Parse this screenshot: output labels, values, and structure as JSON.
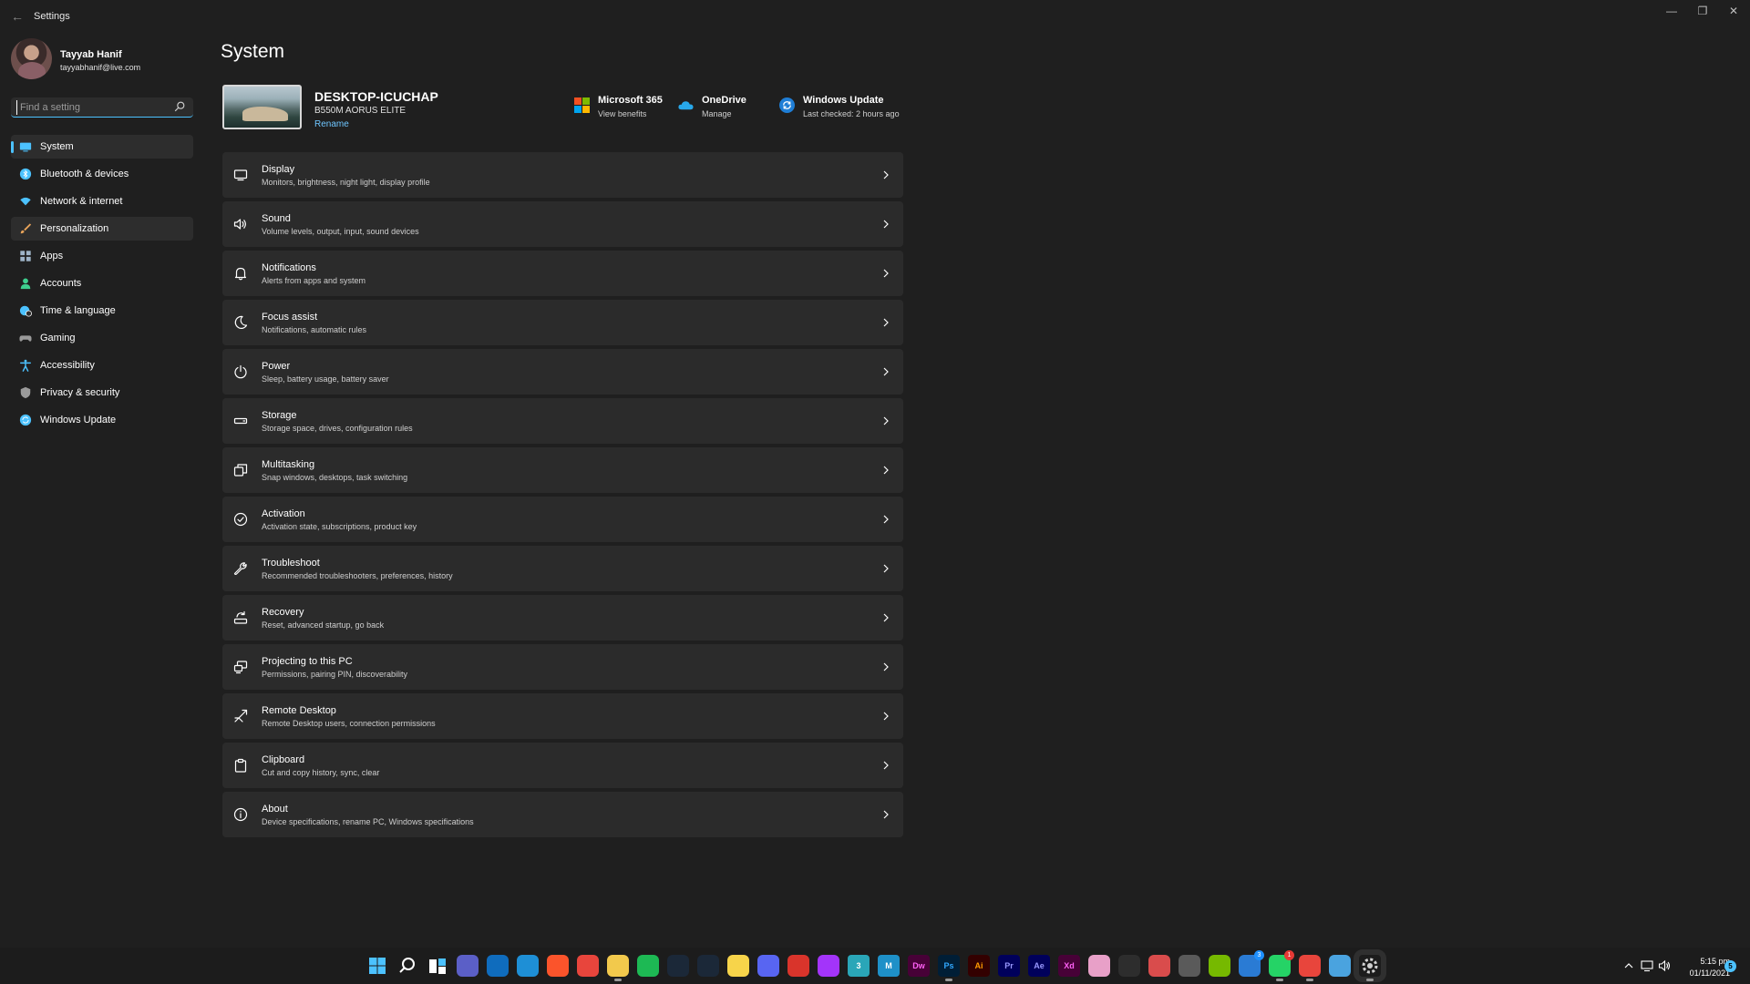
{
  "window": {
    "title": "Settings",
    "back_glyph": "←",
    "minimize_glyph": "—",
    "maximize_glyph": "❐",
    "close_glyph": "✕"
  },
  "user": {
    "name": "Tayyab Hanif",
    "email": "tayyabhanif@live.com"
  },
  "search": {
    "placeholder": "Find a setting",
    "value": ""
  },
  "sidebar": {
    "items": [
      {
        "label": "System",
        "icon": "system-icon",
        "color": "#4cc2ff",
        "active": true
      },
      {
        "label": "Bluetooth & devices",
        "icon": "bluetooth-icon",
        "color": "#4cc2ff"
      },
      {
        "label": "Network & internet",
        "icon": "wifi-icon",
        "color": "#4cc2ff"
      },
      {
        "label": "Personalization",
        "icon": "brush-icon",
        "color": "#e8a35a",
        "hover": true
      },
      {
        "label": "Apps",
        "icon": "apps-icon",
        "color": "#9fb4c8"
      },
      {
        "label": "Accounts",
        "icon": "person-icon",
        "color": "#3ecf8e"
      },
      {
        "label": "Time & language",
        "icon": "globe-clock-icon",
        "color": "#4cc2ff"
      },
      {
        "label": "Gaming",
        "icon": "controller-icon",
        "color": "#9a9a9a"
      },
      {
        "label": "Accessibility",
        "icon": "accessibility-icon",
        "color": "#4cc2ff"
      },
      {
        "label": "Privacy & security",
        "icon": "shield-icon",
        "color": "#9a9a9a"
      },
      {
        "label": "Windows Update",
        "icon": "update-icon",
        "color": "#4cc2ff"
      }
    ]
  },
  "main": {
    "title": "System",
    "device": {
      "name": "DESKTOP-ICUCHAP",
      "model": "B550M AORUS ELITE",
      "rename_label": "Rename"
    },
    "quick_links": [
      {
        "title": "Microsoft 365",
        "subtitle": "View benefits",
        "icon": "microsoft-365-icon"
      },
      {
        "title": "OneDrive",
        "subtitle": "Manage",
        "icon": "onedrive-icon"
      },
      {
        "title": "Windows Update",
        "subtitle": "Last checked: 2 hours ago",
        "icon": "windows-update-icon"
      }
    ],
    "cards": [
      {
        "title": "Display",
        "subtitle": "Monitors, brightness, night light, display profile",
        "icon": "display-icon"
      },
      {
        "title": "Sound",
        "subtitle": "Volume levels, output, input, sound devices",
        "icon": "speaker-icon"
      },
      {
        "title": "Notifications",
        "subtitle": "Alerts from apps and system",
        "icon": "bell-icon"
      },
      {
        "title": "Focus assist",
        "subtitle": "Notifications, automatic rules",
        "icon": "moon-icon"
      },
      {
        "title": "Power",
        "subtitle": "Sleep, battery usage, battery saver",
        "icon": "power-icon"
      },
      {
        "title": "Storage",
        "subtitle": "Storage space, drives, configuration rules",
        "icon": "storage-icon"
      },
      {
        "title": "Multitasking",
        "subtitle": "Snap windows, desktops, task switching",
        "icon": "multitasking-icon"
      },
      {
        "title": "Activation",
        "subtitle": "Activation state, subscriptions, product key",
        "icon": "check-circle-icon"
      },
      {
        "title": "Troubleshoot",
        "subtitle": "Recommended troubleshooters, preferences, history",
        "icon": "wrench-icon"
      },
      {
        "title": "Recovery",
        "subtitle": "Reset, advanced startup, go back",
        "icon": "recovery-icon"
      },
      {
        "title": "Projecting to this PC",
        "subtitle": "Permissions, pairing PIN, discoverability",
        "icon": "projecting-icon"
      },
      {
        "title": "Remote Desktop",
        "subtitle": "Remote Desktop users, connection permissions",
        "icon": "remote-desktop-icon"
      },
      {
        "title": "Clipboard",
        "subtitle": "Cut and copy history, sync, clear",
        "icon": "clipboard-icon"
      },
      {
        "title": "About",
        "subtitle": "Device specifications, rename PC, Windows specifications",
        "icon": "info-icon"
      }
    ]
  },
  "taskbar": {
    "apps": [
      {
        "name": "start-icon",
        "glyph": "",
        "bg": "#1c1c1c"
      },
      {
        "name": "search-icon",
        "glyph": "",
        "bg": "#1c1c1c"
      },
      {
        "name": "task-view-icon",
        "glyph": "",
        "bg": "#1c1c1c"
      },
      {
        "name": "teams-chat-icon",
        "glyph": "",
        "bg": "#5b5fc7"
      },
      {
        "name": "mail-icon",
        "glyph": "",
        "bg": "#0f6cbd"
      },
      {
        "name": "edge-icon",
        "glyph": "",
        "bg": "#1e8fd6"
      },
      {
        "name": "brave-icon",
        "glyph": "",
        "bg": "#fb542b"
      },
      {
        "name": "chrome-icon",
        "glyph": "",
        "bg": "#e8453c"
      },
      {
        "name": "file-explorer-icon",
        "glyph": "",
        "bg": "#f2c94c",
        "active": true
      },
      {
        "name": "spotify-icon",
        "glyph": "",
        "bg": "#1db954"
      },
      {
        "name": "steam-download-icon",
        "glyph": "",
        "bg": "#1b2838"
      },
      {
        "name": "steam-icon",
        "glyph": "",
        "bg": "#1b2838"
      },
      {
        "name": "sticky-notes-icon",
        "glyph": "",
        "bg": "#f7d44a"
      },
      {
        "name": "discord-icon",
        "glyph": "",
        "bg": "#5865f2"
      },
      {
        "name": "pdf-icon",
        "glyph": "",
        "bg": "#d9342b"
      },
      {
        "name": "messenger-icon",
        "glyph": "",
        "bg": "#a334fa"
      },
      {
        "name": "app-3-icon",
        "glyph": "3",
        "bg": "#2aa6b8"
      },
      {
        "name": "app-m-icon",
        "glyph": "M",
        "bg": "#1e90c8"
      },
      {
        "name": "dreamweaver-icon",
        "glyph": "Dw",
        "bg": "#470137",
        "fg": "#ff61f6"
      },
      {
        "name": "photoshop-icon",
        "glyph": "Ps",
        "bg": "#001e36",
        "fg": "#31a8ff",
        "active": true
      },
      {
        "name": "illustrator-icon",
        "glyph": "Ai",
        "bg": "#330000",
        "fg": "#ff9a00"
      },
      {
        "name": "premiere-icon",
        "glyph": "Pr",
        "bg": "#00005b",
        "fg": "#9999ff"
      },
      {
        "name": "after-effects-icon",
        "glyph": "Ae",
        "bg": "#00005b",
        "fg": "#9999ff"
      },
      {
        "name": "xd-icon",
        "glyph": "Xd",
        "bg": "#470137",
        "fg": "#ff61f6"
      },
      {
        "name": "photos-icon",
        "glyph": "",
        "bg": "#e8a0c8"
      },
      {
        "name": "davinci-icon",
        "glyph": "",
        "bg": "#2d2d2d"
      },
      {
        "name": "snipping-icon",
        "glyph": "",
        "bg": "#d94c4c"
      },
      {
        "name": "calculator-icon",
        "glyph": "",
        "bg": "#5a5a5a"
      },
      {
        "name": "nvidia-icon",
        "glyph": "",
        "bg": "#76b900"
      },
      {
        "name": "phone-link-icon",
        "glyph": "",
        "bg": "#2a7bd4",
        "badge": "3",
        "badge_color": "#1e90ff"
      },
      {
        "name": "whatsapp-icon",
        "glyph": "",
        "bg": "#25d366",
        "badge": "1",
        "badge_color": "#e53935",
        "active": true
      },
      {
        "name": "chrome-profile-icon",
        "glyph": "",
        "bg": "#e8453c",
        "active": true
      },
      {
        "name": "notepad-icon",
        "glyph": "",
        "bg": "#4aa3df"
      },
      {
        "name": "settings-icon",
        "glyph": "",
        "bg": "#6b6b6b",
        "active": true,
        "highlighted": true
      }
    ],
    "clock_time": "5:15 pm",
    "clock_date": "01/11/2021",
    "notification_count": "5"
  }
}
